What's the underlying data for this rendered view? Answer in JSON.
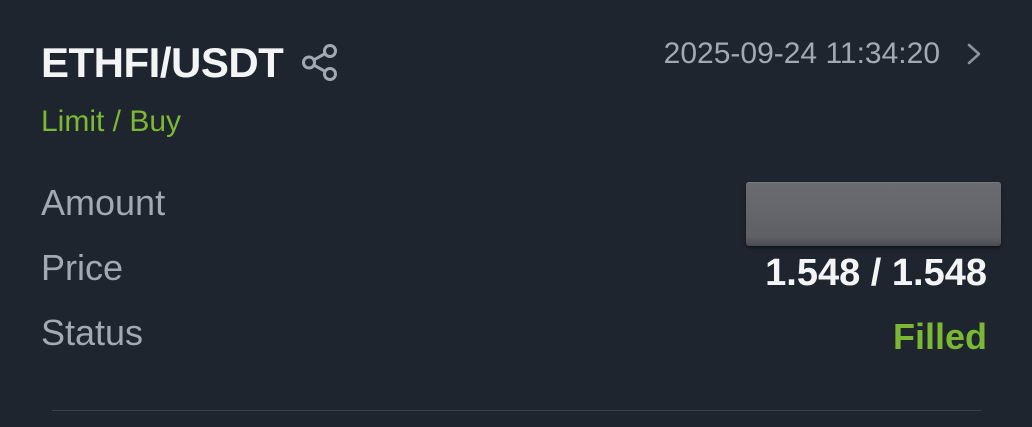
{
  "order": {
    "pair": "ETHFI/USDT",
    "timestamp": "2025-09-24 11:34:20",
    "type_label": "Limit / Buy",
    "amount_label": "Amount",
    "amount_value": "",
    "price_label": "Price",
    "price_value": "1.548 / 1.548",
    "status_label": "Status",
    "status_value": "Filled"
  },
  "icons": {
    "share": "share-icon",
    "detail": "chevron-right-icon"
  },
  "colors": {
    "background": "#1f252f",
    "primary_text": "#f2f4f6",
    "secondary_text": "#a3a9b3",
    "accent_green": "#7bb833",
    "divider": "#3a414c",
    "redaction": "#606267"
  }
}
